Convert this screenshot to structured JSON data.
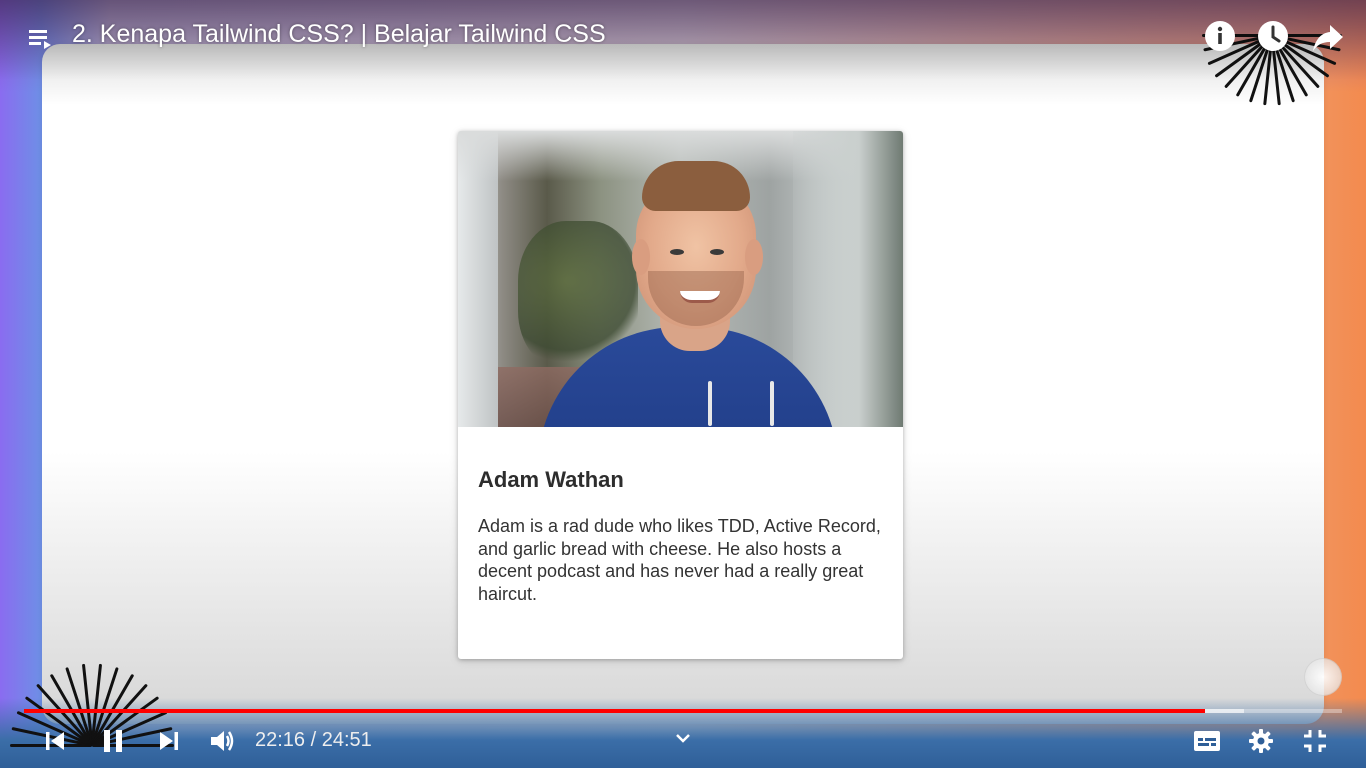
{
  "video": {
    "title": "2. Kenapa Tailwind CSS? | Belajar Tailwind CSS"
  },
  "card": {
    "name": "Adam Wathan",
    "bio": "Adam is a rad dude who likes TDD, Active Record, and garlic bread with cheese. He also hosts a decent podcast and has never had a really great haircut."
  },
  "player": {
    "current_time": "22:16",
    "duration": "24:51",
    "time_display": "22:16 / 24:51",
    "played_fraction": 0.896,
    "buffered_fraction": 0.926,
    "progress_color": "#ff0000"
  },
  "icons": {
    "top_left": "playlist-icon",
    "top_right": [
      "info-icon",
      "watch-later-icon",
      "share-icon"
    ],
    "controls": [
      "previous-icon",
      "pause-icon",
      "next-icon",
      "volume-icon",
      "chevron-down-icon",
      "captions-icon",
      "settings-icon",
      "exit-fullscreen-icon"
    ]
  }
}
